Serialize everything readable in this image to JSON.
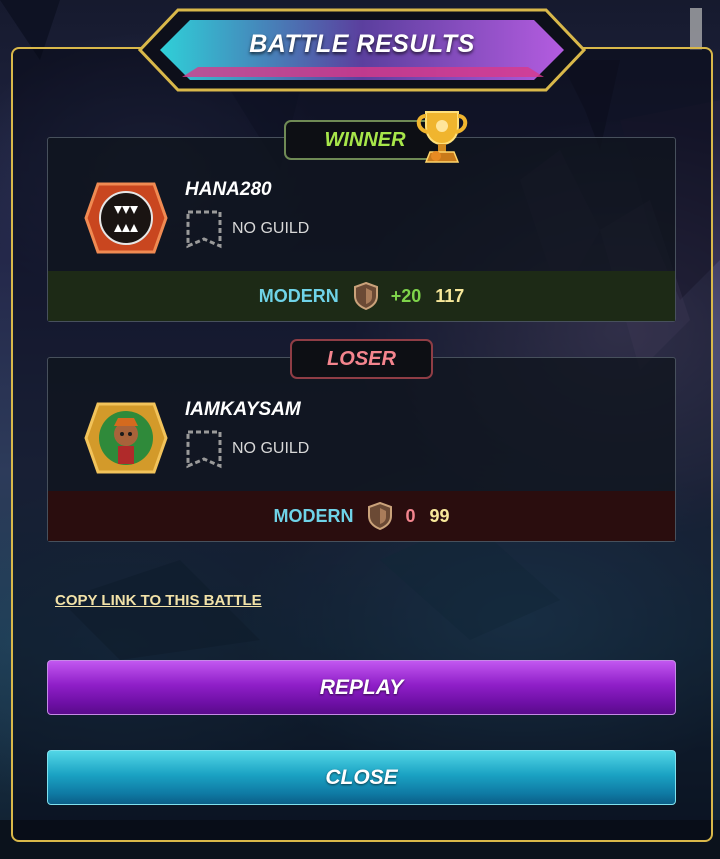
{
  "title": "BATTLE RESULTS",
  "winner": {
    "tag": "WINNER",
    "name": "HANA280",
    "guild": "NO GUILD",
    "format": "MODERN",
    "delta": "+20",
    "rating": "117",
    "avatar_icon": "fanged-monster-icon"
  },
  "loser": {
    "tag": "LOSER",
    "name": "IAMKAYSAM",
    "guild": "NO GUILD",
    "format": "MODERN",
    "delta": "0",
    "rating": "99",
    "avatar_icon": "warrior-portrait-icon"
  },
  "links": {
    "copy_link": "COPY LINK TO THIS BATTLE"
  },
  "buttons": {
    "replay": "REPLAY",
    "close": "CLOSE"
  },
  "colors": {
    "frame_border": "#d9b84a",
    "winner_accent": "#a7e64a",
    "loser_accent": "#f4858e",
    "format_text": "#6fd3e8",
    "rating_text": "#f7e89a",
    "replay_button": "#8f1fc8",
    "close_button": "#1aa2c3"
  }
}
